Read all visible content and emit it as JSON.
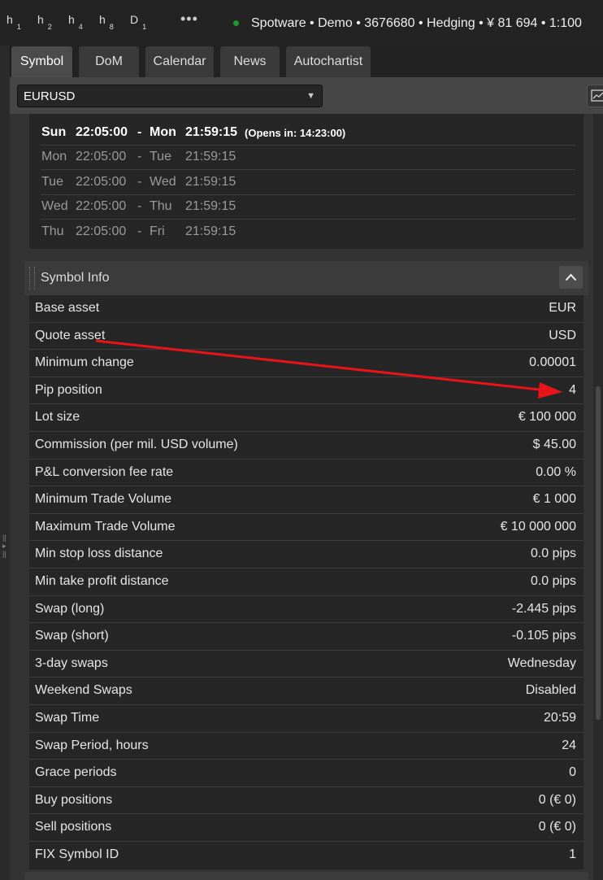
{
  "timeframes": [
    {
      "letter": "h",
      "sub": "1"
    },
    {
      "letter": "h",
      "sub": "2"
    },
    {
      "letter": "h",
      "sub": "4"
    },
    {
      "letter": "h",
      "sub": "8"
    },
    {
      "letter": "D",
      "sub": "1"
    }
  ],
  "more_label": "•••",
  "account_info": "Spotware • Demo • 3676680 • Hedging • ¥ 81 694 • 1:100",
  "tabs": [
    {
      "label": "Symbol",
      "active": true
    },
    {
      "label": "DoM",
      "active": false
    },
    {
      "label": "Calendar",
      "active": false
    },
    {
      "label": "News",
      "active": false
    },
    {
      "label": "Autochartist",
      "active": false
    }
  ],
  "symbol_select": {
    "value": "EURUSD",
    "caret": "▼"
  },
  "sessions": [
    {
      "d1": "Sun",
      "t1": "22:05:00",
      "sep": "-",
      "d2": "Mon",
      "t2": "21:59:15",
      "note": "(Opens in: 14:23:00)",
      "current": true
    },
    {
      "d1": "Mon",
      "t1": "22:05:00",
      "sep": "-",
      "d2": "Tue",
      "t2": "21:59:15",
      "note": "",
      "current": false
    },
    {
      "d1": "Tue",
      "t1": "22:05:00",
      "sep": "-",
      "d2": "Wed",
      "t2": "21:59:15",
      "note": "",
      "current": false
    },
    {
      "d1": "Wed",
      "t1": "22:05:00",
      "sep": "-",
      "d2": "Thu",
      "t2": "21:59:15",
      "note": "",
      "current": false
    },
    {
      "d1": "Thu",
      "t1": "22:05:00",
      "sep": "-",
      "d2": "Fri",
      "t2": "21:59:15",
      "note": "",
      "current": false
    }
  ],
  "symbol_info": {
    "title": "Symbol Info",
    "rows": [
      {
        "label": "Base asset",
        "value": "EUR"
      },
      {
        "label": "Quote asset",
        "value": "USD"
      },
      {
        "label": "Minimum change",
        "value": "0.00001"
      },
      {
        "label": "Pip position",
        "value": "4"
      },
      {
        "label": "Lot size",
        "value": "€ 100 000"
      },
      {
        "label": "Commission (per mil. USD volume)",
        "value": "$ 45.00"
      },
      {
        "label": "P&L conversion fee rate",
        "value": "0.00 %"
      },
      {
        "label": "Minimum Trade Volume",
        "value": "€ 1 000"
      },
      {
        "label": "Maximum Trade Volume",
        "value": "€ 10 000 000"
      },
      {
        "label": "Min stop loss distance",
        "value": "0.0 pips"
      },
      {
        "label": "Min take profit distance",
        "value": "0.0 pips"
      },
      {
        "label": "Swap (long)",
        "value": "-2.445 pips"
      },
      {
        "label": "Swap (short)",
        "value": "-0.105 pips"
      },
      {
        "label": "3-day swaps",
        "value": "Wednesday"
      },
      {
        "label": "Weekend Swaps",
        "value": "Disabled"
      },
      {
        "label": "Swap Time",
        "value": "20:59"
      },
      {
        "label": "Swap Period, hours",
        "value": "24"
      },
      {
        "label": "Grace periods",
        "value": "0"
      },
      {
        "label": "Buy positions",
        "value": "0 (€ 0)"
      },
      {
        "label": "Sell positions",
        "value": "0 (€ 0)"
      },
      {
        "label": "FIX Symbol ID",
        "value": "1"
      }
    ]
  },
  "colors": {
    "arrow": "#e8141a",
    "status_dot": "#1c9c2a"
  }
}
